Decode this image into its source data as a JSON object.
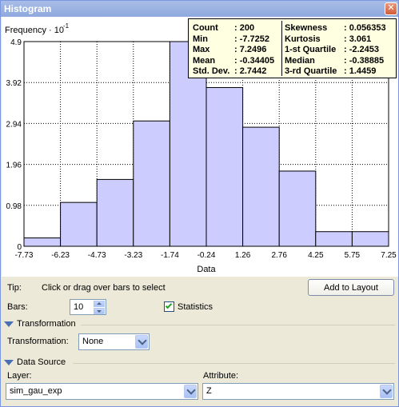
{
  "window": {
    "title": "Histogram",
    "close_label": "✕"
  },
  "stats": {
    "rows": [
      {
        "k1": "Count",
        "v1": ": 200",
        "k2": "Skewness",
        "v2": ": 0.056353"
      },
      {
        "k1": "Min",
        "v1": ": -7.7252",
        "k2": "Kurtosis",
        "v2": ": 3.061"
      },
      {
        "k1": "Max",
        "v1": ": 7.2496",
        "k2": "1-st Quartile",
        "v2": ": -2.2453"
      },
      {
        "k1": "Mean",
        "v1": ": -0.34405",
        "k2": "Median",
        "v2": ": -0.38885"
      },
      {
        "k1": "Std. Dev.",
        "v1": ": 2.7442",
        "k2": "3-rd Quartile",
        "v2": ": 1.4459"
      }
    ]
  },
  "chart_data": {
    "type": "bar",
    "ylabel": "Frequency · 10",
    "ylabel_exponent": "-1",
    "xlabel": "Data",
    "x_ticks": [
      "-7.73",
      "-6.23",
      "-4.73",
      "-3.23",
      "-1.74",
      "-0.24",
      "1.26",
      "2.76",
      "4.25",
      "5.75",
      "7.25"
    ],
    "y_ticks": [
      "0",
      "0.98",
      "1.96",
      "2.94",
      "3.92",
      "4.9"
    ],
    "ylim": [
      0,
      4.9
    ],
    "values": [
      0.2,
      1.05,
      1.6,
      3.0,
      4.9,
      3.8,
      2.85,
      1.8,
      0.35,
      0.35
    ],
    "grid": true,
    "bar_color": "#ccccff"
  },
  "controls": {
    "tip_label": "Tip:",
    "tip_text": "Click or drag over bars to select",
    "add_to_layout": "Add to Layout",
    "bars_label": "Bars:",
    "bars_value": "10",
    "statistics_label": "Statistics",
    "statistics_checked": true,
    "transformation_group": "Transformation",
    "transformation_label": "Transformation:",
    "transformation_value": "None",
    "data_source_group": "Data Source",
    "layer_label": "Layer:",
    "layer_value": "sim_gau_exp",
    "attribute_label": "Attribute:",
    "attribute_value": "Z"
  }
}
